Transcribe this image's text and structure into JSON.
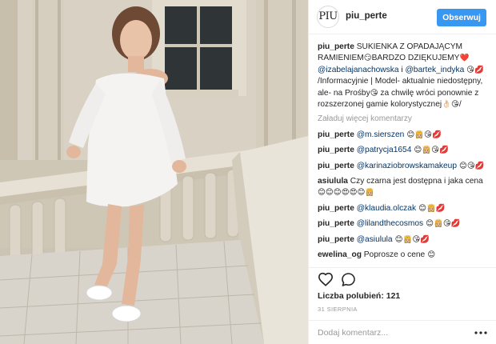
{
  "header": {
    "avatar_text": "PIU",
    "username": "piu_perte",
    "follow_label": "Obserwuj"
  },
  "caption": {
    "username": "piu_perte",
    "text1": "SUKIENKA Z OPADAJĄCYM RAMIENIEM",
    "emoji1": "😏",
    "text2": "BARDZO DZIĘKUJEMY",
    "emoji2": "❤️",
    "mention1": "@izabelajanachowska",
    "text3": " i ",
    "mention2": "@bartek_indyka",
    "emoji3": "😘💋",
    "text4": " /Informacyjnie | Model- aktualnie niedostępny, ale- na Prośby",
    "emoji4": "😘",
    "text5": " za chwilę wróci ponownie z rozszerzonej gamie kolorystycznej",
    "emoji5": "👌🏻😘",
    "text6": "/"
  },
  "load_more": "Załaduj więcej komentarzy",
  "comments": [
    {
      "user": "piu_perte",
      "mention": "@m.sierszen",
      "text": "",
      "emoji": " 😊👸🏼😘💋"
    },
    {
      "user": "piu_perte",
      "mention": "@patrycja1654",
      "text": "",
      "emoji": " 😊👸🏼😘💋"
    },
    {
      "user": "piu_perte",
      "mention": "@karinaziobrowskamakeup",
      "text": "",
      "emoji": " 😊😘💋"
    },
    {
      "user": "asiulula",
      "mention": "",
      "text": "Czy czarna jest dostępna i jaka cena",
      "emoji": " 😊😊😊😍😍😊👸🏼"
    },
    {
      "user": "piu_perte",
      "mention": "@klaudia.olczak",
      "text": "",
      "emoji": " 😊👸🏼💋"
    },
    {
      "user": "piu_perte",
      "mention": "@lilandthecosmos",
      "text": "",
      "emoji": " 😊👸🏼😘💋"
    },
    {
      "user": "piu_perte",
      "mention": "@asiulula",
      "text": "",
      "emoji": " 😊👸🏼😘💋"
    },
    {
      "user": "ewelina_og",
      "mention": "",
      "text": "Poprosze o cene",
      "emoji": " 😊"
    }
  ],
  "actions": {
    "heart_icon": "heart-icon",
    "comment_icon": "comment-bubble-icon",
    "likes_label": "Liczba polubień: 121",
    "date": "31 SIERPNIA",
    "add_comment_placeholder": "Dodaj komentarz...",
    "more_icon": "ellipsis-icon"
  },
  "colors": {
    "follow_button": "#3897f0",
    "mention": "#003569",
    "muted": "#999999",
    "border": "#efefef"
  }
}
